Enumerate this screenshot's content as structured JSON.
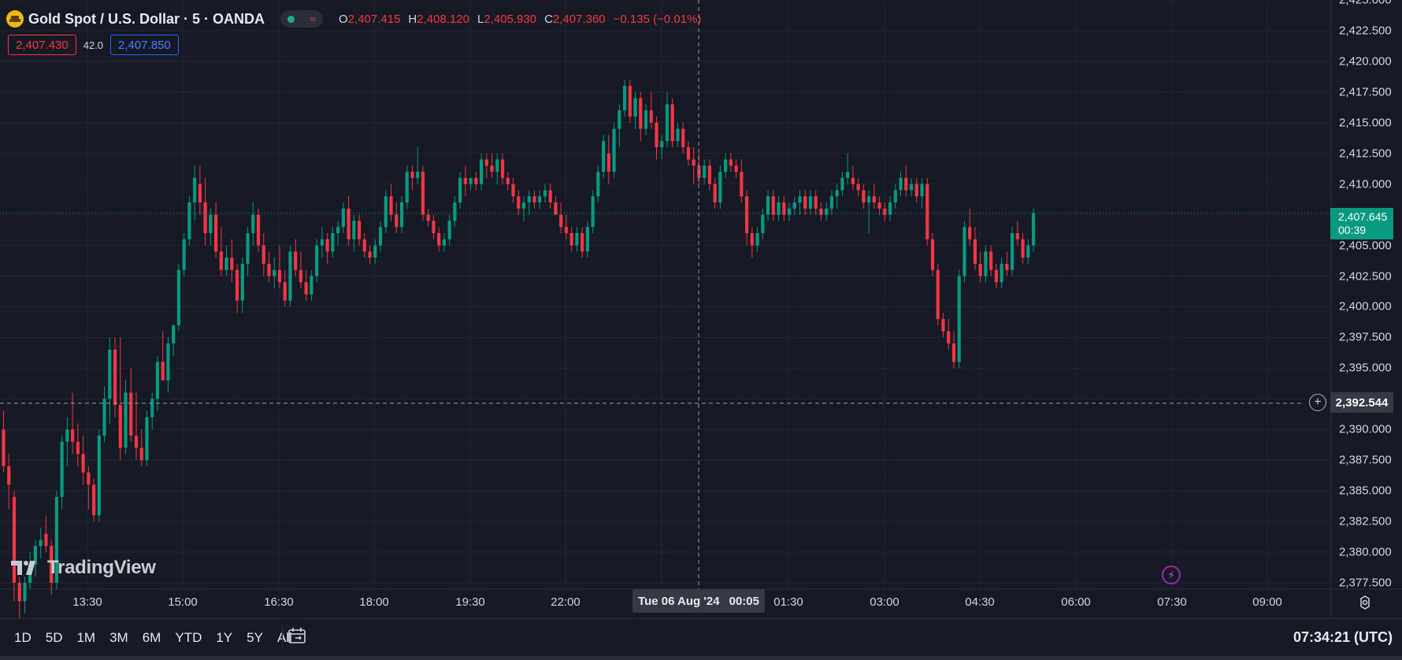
{
  "legend": {
    "symbol": "Gold Spot / U.S. Dollar · 5 · OANDA",
    "wave_glyph": "≈",
    "open_key": "O",
    "open": "2,407.415",
    "high_key": "H",
    "high": "2,408.120",
    "low_key": "L",
    "low": "2,405.930",
    "close_key": "C",
    "close": "2,407.360",
    "change": "−0.135 (−0.01%)"
  },
  "quote": {
    "sell": "2,407.430",
    "spread": "42.0",
    "buy": "2,407.850"
  },
  "price_axis": {
    "labels": [
      "2,422.500",
      "2,420.000",
      "2,417.500",
      "2,415.000",
      "2,412.500",
      "2,410.000",
      "2,407.500",
      "2,405.000",
      "2,402.500",
      "2,400.000",
      "2,397.500",
      "2,395.000",
      "2,392.500",
      "2,390.000",
      "2,387.500",
      "2,385.000",
      "2,382.500",
      "2,380.000",
      "2,377.500"
    ],
    "top_partial": "2,425.000",
    "last_price": "2,407.645",
    "countdown": "00:39",
    "crosshair_price": "2,392.544"
  },
  "time_axis": {
    "labels": [
      "13:30",
      "15:00",
      "16:30",
      "18:00",
      "19:30",
      "22:00",
      "01:30",
      "03:00",
      "04:30",
      "06:00",
      "07:30",
      "09:00"
    ],
    "crosshair_date": "Tue 06 Aug '24",
    "crosshair_time": "00:05"
  },
  "watermark": "TradingView",
  "ranges": [
    "1D",
    "5D",
    "1M",
    "3M",
    "6M",
    "YTD",
    "1Y",
    "5Y",
    "All"
  ],
  "clock": "07:34:21 (UTC)",
  "colors": {
    "up": "#089981",
    "down": "#f23645",
    "background": "#161a25",
    "grid": "#232632"
  },
  "chart_data": {
    "type": "candlestick",
    "title": "Gold Spot / U.S. Dollar · 5 · OANDA",
    "ylim": [
      2377,
      2425
    ],
    "x_start_time": "12:20",
    "interval_minutes": 5,
    "ohlc": [
      [
        2390.0,
        2391.5,
        2386.5,
        2387.0
      ],
      [
        2387.0,
        2388.0,
        2383.5,
        2385.5
      ],
      [
        2384.5,
        2385.0,
        2376.0,
        2377.5
      ],
      [
        2377.5,
        2378.0,
        2374.0,
        2376.0
      ],
      [
        2376.0,
        2378.0,
        2375.0,
        2377.5
      ],
      [
        2377.5,
        2380.0,
        2377.0,
        2379.0
      ],
      [
        2379.0,
        2381.0,
        2378.0,
        2380.5
      ],
      [
        2380.5,
        2382.0,
        2379.5,
        2381.0
      ],
      [
        2381.5,
        2383.0,
        2380.0,
        2380.5
      ],
      [
        2380.5,
        2381.0,
        2376.5,
        2377.5
      ],
      [
        2377.5,
        2385.0,
        2377.0,
        2384.5
      ],
      [
        2384.5,
        2389.5,
        2383.5,
        2389.0
      ],
      [
        2389.0,
        2391.0,
        2387.0,
        2390.0
      ],
      [
        2390.0,
        2393.0,
        2388.0,
        2389.0
      ],
      [
        2389.0,
        2390.5,
        2387.0,
        2388.0
      ],
      [
        2388.0,
        2389.5,
        2385.5,
        2386.5
      ],
      [
        2386.5,
        2387.0,
        2383.5,
        2385.5
      ],
      [
        2385.5,
        2386.0,
        2382.5,
        2383.0
      ],
      [
        2383.0,
        2390.0,
        2382.5,
        2389.5
      ],
      [
        2389.5,
        2393.5,
        2389.0,
        2392.5
      ],
      [
        2392.5,
        2397.5,
        2390.5,
        2396.5
      ],
      [
        2396.5,
        2397.5,
        2391.0,
        2392.0
      ],
      [
        2392.0,
        2397.5,
        2387.5,
        2388.5
      ],
      [
        2388.5,
        2394.0,
        2388.0,
        2393.0
      ],
      [
        2393.0,
        2395.0,
        2389.0,
        2389.5
      ],
      [
        2389.5,
        2393.0,
        2387.5,
        2388.5
      ],
      [
        2388.5,
        2390.0,
        2387.0,
        2387.5
      ],
      [
        2387.5,
        2391.5,
        2387.0,
        2391.0
      ],
      [
        2391.0,
        2393.0,
        2390.0,
        2392.5
      ],
      [
        2392.5,
        2396.0,
        2391.5,
        2395.5
      ],
      [
        2395.5,
        2398.0,
        2394.0,
        2394.0
      ],
      [
        2394.0,
        2397.5,
        2393.0,
        2397.0
      ],
      [
        2397.0,
        2398.5,
        2396.0,
        2398.5
      ],
      [
        2398.5,
        2403.5,
        2398.0,
        2403.0
      ],
      [
        2403.0,
        2406.0,
        2402.5,
        2405.5
      ],
      [
        2405.5,
        2409.0,
        2405.0,
        2408.5
      ],
      [
        2408.5,
        2411.5,
        2407.0,
        2410.5
      ],
      [
        2410.0,
        2411.5,
        2407.5,
        2408.5
      ],
      [
        2408.5,
        2410.5,
        2405.0,
        2406.0
      ],
      [
        2406.0,
        2408.0,
        2405.0,
        2407.5
      ],
      [
        2407.5,
        2408.5,
        2404.0,
        2404.5
      ],
      [
        2404.5,
        2406.5,
        2402.5,
        2403.0
      ],
      [
        2403.0,
        2405.0,
        2402.5,
        2404.0
      ],
      [
        2404.0,
        2405.5,
        2402.0,
        2403.0
      ],
      [
        2403.0,
        2403.5,
        2399.5,
        2400.5
      ],
      [
        2400.5,
        2404.0,
        2399.5,
        2403.5
      ],
      [
        2403.5,
        2406.5,
        2402.5,
        2406.0
      ],
      [
        2406.0,
        2408.5,
        2405.0,
        2407.5
      ],
      [
        2407.5,
        2408.0,
        2404.5,
        2405.0
      ],
      [
        2405.0,
        2406.0,
        2402.5,
        2403.5
      ],
      [
        2403.5,
        2404.5,
        2402.0,
        2402.5
      ],
      [
        2402.5,
        2404.0,
        2401.5,
        2403.0
      ],
      [
        2403.0,
        2405.0,
        2401.5,
        2402.0
      ],
      [
        2402.0,
        2403.0,
        2400.0,
        2400.5
      ],
      [
        2400.5,
        2405.0,
        2400.0,
        2404.5
      ],
      [
        2404.5,
        2405.5,
        2402.5,
        2403.0
      ],
      [
        2403.0,
        2404.5,
        2401.5,
        2402.0
      ],
      [
        2402.0,
        2403.0,
        2400.5,
        2401.0
      ],
      [
        2401.0,
        2403.0,
        2400.5,
        2402.5
      ],
      [
        2402.5,
        2405.5,
        2402.0,
        2405.0
      ],
      [
        2405.0,
        2406.5,
        2404.0,
        2405.5
      ],
      [
        2405.5,
        2406.0,
        2403.5,
        2404.5
      ],
      [
        2404.5,
        2406.5,
        2404.0,
        2406.0
      ],
      [
        2406.0,
        2407.0,
        2405.0,
        2406.5
      ],
      [
        2406.5,
        2408.5,
        2406.0,
        2408.0
      ],
      [
        2408.0,
        2409.0,
        2405.0,
        2405.5
      ],
      [
        2405.5,
        2407.5,
        2404.5,
        2407.0
      ],
      [
        2407.0,
        2407.5,
        2405.0,
        2405.5
      ],
      [
        2405.5,
        2406.0,
        2404.0,
        2404.5
      ],
      [
        2404.5,
        2405.0,
        2403.5,
        2404.0
      ],
      [
        2404.0,
        2405.5,
        2403.5,
        2405.0
      ],
      [
        2405.0,
        2407.0,
        2404.5,
        2406.5
      ],
      [
        2406.5,
        2409.5,
        2406.0,
        2409.0
      ],
      [
        2409.0,
        2410.0,
        2407.0,
        2407.5
      ],
      [
        2407.5,
        2408.5,
        2406.0,
        2406.5
      ],
      [
        2406.5,
        2409.0,
        2406.0,
        2408.5
      ],
      [
        2408.5,
        2411.5,
        2408.0,
        2411.0
      ],
      [
        2411.0,
        2411.5,
        2409.5,
        2410.5
      ],
      [
        2410.5,
        2413.0,
        2410.0,
        2411.0
      ],
      [
        2411.0,
        2411.5,
        2407.0,
        2407.5
      ],
      [
        2407.5,
        2408.0,
        2406.5,
        2407.0
      ],
      [
        2407.0,
        2407.5,
        2405.5,
        2406.0
      ],
      [
        2406.0,
        2406.5,
        2404.5,
        2405.0
      ],
      [
        2405.0,
        2406.0,
        2404.5,
        2405.5
      ],
      [
        2405.5,
        2407.5,
        2405.0,
        2407.0
      ],
      [
        2407.0,
        2409.0,
        2406.5,
        2408.5
      ],
      [
        2408.5,
        2411.0,
        2408.0,
        2410.5
      ],
      [
        2410.5,
        2411.5,
        2409.0,
        2410.0
      ],
      [
        2410.0,
        2410.5,
        2409.5,
        2410.5
      ],
      [
        2410.5,
        2411.0,
        2409.5,
        2410.0
      ],
      [
        2410.0,
        2412.5,
        2409.5,
        2412.0
      ],
      [
        2412.0,
        2412.5,
        2410.5,
        2411.5
      ],
      [
        2411.5,
        2412.5,
        2410.5,
        2411.0
      ],
      [
        2411.0,
        2412.5,
        2410.0,
        2412.0
      ],
      [
        2412.0,
        2412.5,
        2410.0,
        2410.5
      ],
      [
        2410.5,
        2411.0,
        2409.5,
        2410.0
      ],
      [
        2410.0,
        2410.5,
        2408.5,
        2409.0
      ],
      [
        2409.0,
        2409.5,
        2407.5,
        2408.0
      ],
      [
        2408.0,
        2409.0,
        2407.0,
        2408.5
      ],
      [
        2408.5,
        2409.5,
        2407.5,
        2409.0
      ],
      [
        2409.0,
        2409.5,
        2408.0,
        2408.5
      ],
      [
        2408.5,
        2409.5,
        2408.0,
        2409.0
      ],
      [
        2409.0,
        2410.0,
        2408.5,
        2409.5
      ],
      [
        2409.5,
        2410.0,
        2408.0,
        2408.5
      ],
      [
        2408.5,
        2409.0,
        2407.5,
        2407.5
      ],
      [
        2407.5,
        2408.5,
        2406.0,
        2406.5
      ],
      [
        2406.5,
        2407.5,
        2405.5,
        2406.0
      ],
      [
        2406.0,
        2406.5,
        2404.5,
        2405.0
      ],
      [
        2405.0,
        2406.5,
        2404.5,
        2406.0
      ],
      [
        2406.0,
        2406.5,
        2404.0,
        2404.5
      ],
      [
        2404.5,
        2407.0,
        2404.0,
        2406.5
      ],
      [
        2406.5,
        2409.5,
        2406.0,
        2409.0
      ],
      [
        2409.0,
        2411.5,
        2408.5,
        2411.0
      ],
      [
        2411.0,
        2414.0,
        2410.5,
        2413.5
      ],
      [
        2412.5,
        2414.0,
        2410.0,
        2411.0
      ],
      [
        2411.0,
        2415.0,
        2410.5,
        2414.5
      ],
      [
        2414.5,
        2416.5,
        2413.0,
        2416.0
      ],
      [
        2416.0,
        2418.5,
        2415.5,
        2418.0
      ],
      [
        2418.0,
        2418.5,
        2415.0,
        2415.5
      ],
      [
        2415.5,
        2417.5,
        2414.5,
        2417.0
      ],
      [
        2417.0,
        2417.5,
        2413.5,
        2414.5
      ],
      [
        2414.5,
        2416.5,
        2414.0,
        2416.0
      ],
      [
        2416.0,
        2417.5,
        2414.5,
        2415.0
      ],
      [
        2415.0,
        2415.5,
        2412.0,
        2413.0
      ],
      [
        2413.0,
        2414.0,
        2412.0,
        2413.5
      ],
      [
        2413.5,
        2417.5,
        2413.0,
        2416.5
      ],
      [
        2416.5,
        2417.0,
        2413.0,
        2413.5
      ],
      [
        2413.5,
        2415.0,
        2413.0,
        2414.5
      ],
      [
        2414.5,
        2415.0,
        2412.5,
        2413.0
      ],
      [
        2413.0,
        2413.5,
        2411.5,
        2412.0
      ],
      [
        2412.0,
        2413.0,
        2410.0,
        2411.5
      ],
      [
        2411.5,
        2412.5,
        2410.0,
        2410.5
      ],
      [
        2410.5,
        2412.0,
        2410.0,
        2411.5
      ],
      [
        2411.5,
        2412.0,
        2409.5,
        2410.0
      ],
      [
        2410.0,
        2410.5,
        2408.0,
        2408.5
      ],
      [
        2408.5,
        2411.5,
        2408.0,
        2411.0
      ],
      [
        2411.0,
        2412.5,
        2410.5,
        2412.0
      ],
      [
        2412.0,
        2412.5,
        2411.0,
        2411.5
      ],
      [
        2411.5,
        2412.0,
        2410.5,
        2411.0
      ],
      [
        2411.0,
        2412.0,
        2408.5,
        2409.0
      ],
      [
        2409.0,
        2409.5,
        2405.0,
        2406.0
      ],
      [
        2406.0,
        2406.5,
        2404.0,
        2405.0
      ],
      [
        2405.0,
        2406.5,
        2404.5,
        2406.0
      ],
      [
        2406.0,
        2408.0,
        2405.5,
        2407.5
      ],
      [
        2407.5,
        2409.5,
        2407.0,
        2409.0
      ],
      [
        2409.0,
        2409.5,
        2407.0,
        2407.5
      ],
      [
        2407.5,
        2409.0,
        2407.0,
        2408.5
      ],
      [
        2408.5,
        2409.0,
        2407.0,
        2407.5
      ],
      [
        2407.5,
        2408.5,
        2407.0,
        2408.0
      ],
      [
        2408.0,
        2409.0,
        2407.5,
        2408.5
      ],
      [
        2408.5,
        2409.5,
        2407.5,
        2409.0
      ],
      [
        2409.0,
        2409.5,
        2407.5,
        2408.0
      ],
      [
        2408.0,
        2409.5,
        2407.5,
        2409.0
      ],
      [
        2409.0,
        2409.5,
        2407.5,
        2408.0
      ],
      [
        2408.0,
        2408.5,
        2407.0,
        2407.5
      ],
      [
        2407.5,
        2408.5,
        2407.0,
        2408.0
      ],
      [
        2408.0,
        2409.5,
        2407.5,
        2409.0
      ],
      [
        2409.0,
        2410.0,
        2408.0,
        2409.5
      ],
      [
        2409.5,
        2411.0,
        2409.0,
        2410.5
      ],
      [
        2410.5,
        2412.5,
        2410.0,
        2411.0
      ],
      [
        2410.5,
        2411.5,
        2409.5,
        2410.0
      ],
      [
        2410.0,
        2410.5,
        2409.0,
        2409.5
      ],
      [
        2409.5,
        2410.0,
        2408.0,
        2408.5
      ],
      [
        2408.5,
        2409.5,
        2406.0,
        2409.0
      ],
      [
        2409.0,
        2410.0,
        2408.0,
        2408.5
      ],
      [
        2408.5,
        2409.0,
        2407.5,
        2408.0
      ],
      [
        2408.0,
        2408.5,
        2407.0,
        2407.5
      ],
      [
        2407.5,
        2409.0,
        2407.0,
        2408.5
      ],
      [
        2408.5,
        2410.0,
        2408.0,
        2409.5
      ],
      [
        2409.5,
        2411.0,
        2409.0,
        2410.5
      ],
      [
        2410.5,
        2411.5,
        2409.0,
        2409.5
      ],
      [
        2409.5,
        2410.5,
        2409.0,
        2410.0
      ],
      [
        2410.0,
        2410.5,
        2408.5,
        2409.0
      ],
      [
        2409.0,
        2410.5,
        2408.0,
        2410.0
      ],
      [
        2410.0,
        2410.5,
        2405.0,
        2405.5
      ],
      [
        2405.5,
        2406.0,
        2402.5,
        2403.0
      ],
      [
        2403.0,
        2403.5,
        2398.5,
        2399.0
      ],
      [
        2399.0,
        2399.5,
        2397.5,
        2398.0
      ],
      [
        2398.0,
        2399.0,
        2396.5,
        2397.0
      ],
      [
        2397.0,
        2398.0,
        2395.0,
        2395.5
      ],
      [
        2395.5,
        2403.0,
        2395.0,
        2402.5
      ],
      [
        2402.5,
        2407.0,
        2402.0,
        2406.5
      ],
      [
        2406.5,
        2408.0,
        2405.0,
        2405.5
      ],
      [
        2405.5,
        2406.5,
        2403.0,
        2403.5
      ],
      [
        2403.5,
        2404.5,
        2402.0,
        2402.5
      ],
      [
        2402.5,
        2405.0,
        2402.0,
        2404.5
      ],
      [
        2404.5,
        2405.0,
        2402.5,
        2403.0
      ],
      [
        2403.0,
        2403.5,
        2401.5,
        2402.0
      ],
      [
        2402.0,
        2404.0,
        2401.5,
        2403.5
      ],
      [
        2403.5,
        2404.5,
        2402.5,
        2403.0
      ],
      [
        2403.0,
        2406.5,
        2402.5,
        2406.0
      ],
      [
        2406.0,
        2407.0,
        2405.0,
        2405.5
      ],
      [
        2405.5,
        2406.0,
        2403.5,
        2404.0
      ],
      [
        2404.0,
        2405.5,
        2403.5,
        2405.0
      ],
      [
        2405.0,
        2408.0,
        2404.5,
        2407.645
      ]
    ]
  }
}
